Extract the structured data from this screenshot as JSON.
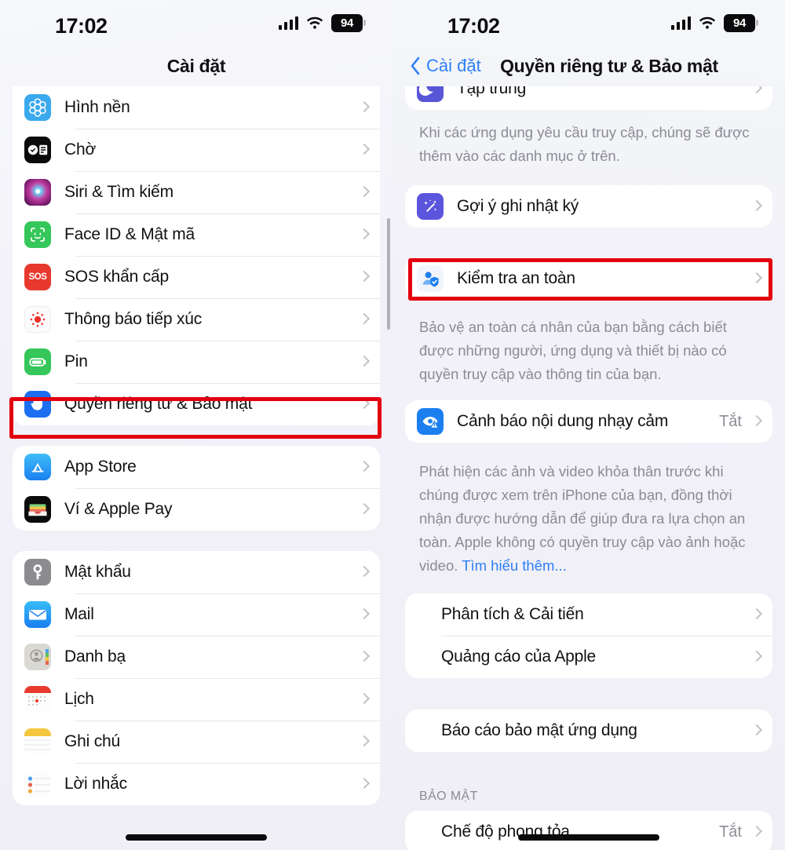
{
  "colors": {
    "accent": "#2d7ef7",
    "highlight": "#e3000f",
    "page_bg": "#f1f0f7",
    "card_bg": "#ffffff",
    "label": "#111114",
    "secondary_label": "#8b8b93"
  },
  "left_phone": {
    "status": {
      "time": "17:02",
      "battery": "94",
      "signal_icon": "cellular-bars-icon",
      "wifi_icon": "wifi-icon",
      "battery_icon": "battery-badge-icon"
    },
    "nav": {
      "title": "Cài đặt"
    },
    "groups": [
      {
        "name": "group-personalization",
        "rows": [
          {
            "icon": "wallpaper-icon",
            "label": "Hình nền",
            "value": "",
            "highlighted": false
          },
          {
            "icon": "standby-icon",
            "label": "Chờ",
            "value": "",
            "highlighted": false
          },
          {
            "icon": "siri-icon",
            "label": "Siri & Tìm kiếm",
            "value": "",
            "highlighted": false
          },
          {
            "icon": "face-id-icon",
            "label": "Face ID & Mật mã",
            "value": "",
            "highlighted": false
          },
          {
            "icon": "sos-icon",
            "label": "SOS khẩn cấp",
            "value": "",
            "highlighted": false
          },
          {
            "icon": "exposure-notification-icon",
            "label": "Thông báo tiếp xúc",
            "value": "",
            "highlighted": false
          },
          {
            "icon": "battery-icon",
            "label": "Pin",
            "value": "",
            "highlighted": false
          },
          {
            "icon": "privacy-hand-icon",
            "label": "Quyền riêng tư & Bảo mật",
            "value": "",
            "highlighted": true
          }
        ]
      },
      {
        "name": "group-store",
        "rows": [
          {
            "icon": "app-store-icon",
            "label": "App Store",
            "value": "",
            "highlighted": false
          },
          {
            "icon": "wallet-icon",
            "label": "Ví & Apple Pay",
            "value": "",
            "highlighted": false
          }
        ]
      },
      {
        "name": "group-apps",
        "rows": [
          {
            "icon": "passwords-key-icon",
            "label": "Mật khẩu",
            "value": "",
            "highlighted": false
          },
          {
            "icon": "mail-icon",
            "label": "Mail",
            "value": "",
            "highlighted": false
          },
          {
            "icon": "contacts-icon",
            "label": "Danh bạ",
            "value": "",
            "highlighted": false
          },
          {
            "icon": "calendar-icon",
            "label": "Lịch",
            "value": "",
            "highlighted": false
          },
          {
            "icon": "notes-icon",
            "label": "Ghi chú",
            "value": "",
            "highlighted": false
          },
          {
            "icon": "reminders-icon",
            "label": "Lời nhắc",
            "value": "",
            "highlighted": false
          }
        ]
      }
    ]
  },
  "right_phone": {
    "status": {
      "time": "17:02",
      "battery": "94",
      "signal_icon": "cellular-bars-icon",
      "wifi_icon": "wifi-icon",
      "battery_icon": "battery-badge-icon"
    },
    "nav": {
      "back_label": "Cài đặt",
      "back_icon": "chevron-left-icon",
      "title": "Quyền riêng tư & Bảo mật"
    },
    "partial_row": {
      "icon": "focus-icon",
      "label": "Tập trung"
    },
    "footnote_1": "Khi các ứng dụng yêu cầu truy cập, chúng sẽ được thêm vào các danh mục ở trên.",
    "journaling": {
      "icon": "journaling-suggestions-icon",
      "label": "Gợi ý ghi nhật ký",
      "value": ""
    },
    "safety_check": {
      "icon": "safety-check-icon",
      "label": "Kiểm tra an toàn",
      "value": "",
      "highlighted": true
    },
    "footnote_2": "Bảo vệ an toàn cá nhân của bạn bằng cách biết được những người, ứng dụng và thiết bị nào có quyền truy cập vào thông tin của bạn.",
    "sensitive": {
      "icon": "sensitive-content-warning-icon",
      "label": "Cảnh báo nội dung nhạy cảm",
      "value": "Tắt"
    },
    "footnote_3_text": "Phát hiện các ảnh và video khỏa thân trước khi chúng được xem trên iPhone của bạn, đồng thời nhận được hướng dẫn để giúp đưa ra lựa chọn an toàn. Apple không có quyền truy cập vào ảnh hoặc video. ",
    "footnote_3_link": "Tìm hiểu thêm...",
    "analytics_group": [
      {
        "label": "Phân tích & Cải tiến",
        "value": ""
      },
      {
        "label": "Quảng cáo của Apple",
        "value": ""
      }
    ],
    "app_privacy_group": [
      {
        "label": "Báo cáo bảo mật ứng dụng",
        "value": ""
      }
    ],
    "security_section_header": "BẢO MẬT",
    "security_group": [
      {
        "label": "Chế độ phong tỏa",
        "value": "Tắt"
      }
    ]
  }
}
